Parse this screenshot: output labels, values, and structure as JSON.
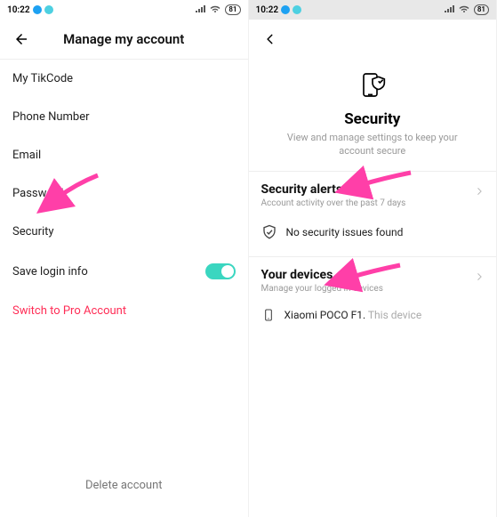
{
  "status": {
    "time": "10:22",
    "battery": "81"
  },
  "left": {
    "title": "Manage my account",
    "items": {
      "tikcode": "My TikCode",
      "phone": "Phone Number",
      "email": "Email",
      "password": "Password",
      "security": "Security",
      "save_login": "Save login info",
      "switch_pro": "Switch to Pro Account"
    },
    "delete": "Delete account"
  },
  "right": {
    "heading": "Security",
    "subheading": "View and manage settings to keep your account secure",
    "alerts": {
      "title": "Security alerts",
      "sub": "Account activity over the past 7 days",
      "status": "No security issues found"
    },
    "devices": {
      "title": "Your devices",
      "sub": "Manage your logged in devices",
      "device_name": "Xiaomi POCO F1.",
      "device_suffix": "This device"
    }
  }
}
